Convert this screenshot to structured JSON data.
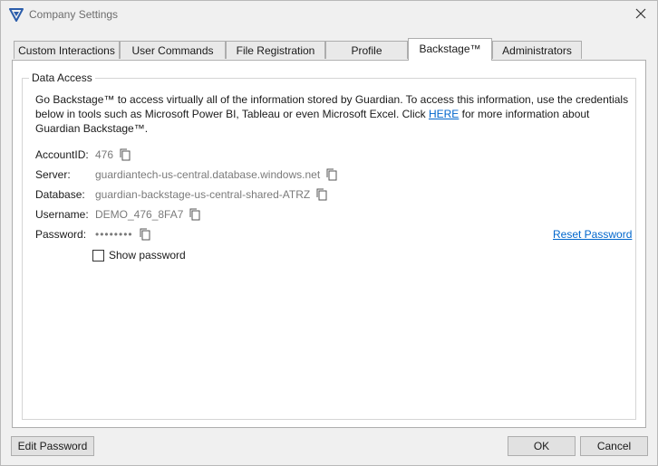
{
  "window": {
    "title": "Company Settings",
    "close_icon": "close-icon",
    "app_icon": "guardian-logo-icon"
  },
  "tabs": [
    {
      "label": "Custom Interactions",
      "active": false
    },
    {
      "label": "User Commands",
      "active": false
    },
    {
      "label": "File Registration",
      "active": false
    },
    {
      "label": "Profile",
      "active": false
    },
    {
      "label": "Backstage™",
      "active": true
    },
    {
      "label": "Administrators",
      "active": false
    }
  ],
  "data_access": {
    "group_label": "Data Access",
    "description_before_link": "Go Backstage™ to access virtually all of the information stored by Guardian. To access this information, use the credentials below in tools such as Microsoft Power BI, Tableau or even Microsoft Excel. Click ",
    "link_text": "HERE",
    "description_after_link": " for more information about Guardian Backstage™.",
    "fields": {
      "account_id": {
        "label": "AccountID:",
        "value": "476"
      },
      "server": {
        "label": "Server:",
        "value": "guardiantech-us-central.database.windows.net"
      },
      "database": {
        "label": "Database:",
        "value": "guardian-backstage-us-central-shared-ATRZ"
      },
      "username": {
        "label": "Username:",
        "value": "DEMO_476_8FA7"
      },
      "password": {
        "label": "Password:",
        "value": "••••••••"
      }
    },
    "copy_icon": "copy-icon",
    "reset_password": "Reset Password",
    "show_password": {
      "label": "Show password",
      "checked": false
    }
  },
  "buttons": {
    "edit_password": "Edit Password",
    "ok": "OK",
    "cancel": "Cancel"
  },
  "colors": {
    "link": "#0066cc",
    "logo": "#2b5dab"
  }
}
